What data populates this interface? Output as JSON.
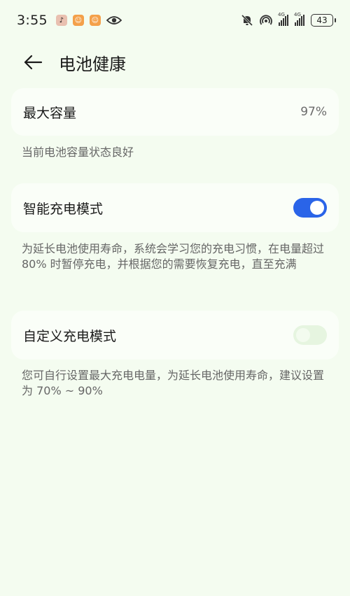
{
  "status_bar": {
    "time": "3:55",
    "battery_level": "43",
    "signal_1_label": "4G",
    "signal_2_label": "4G"
  },
  "header": {
    "title": "电池健康"
  },
  "max_capacity": {
    "label": "最大容量",
    "value": "97%",
    "description": "当前电池容量状态良好"
  },
  "smart_charging": {
    "label": "智能充电模式",
    "enabled": true,
    "description": "为延长电池使用寿命，系统会学习您的充电习惯，在电量超过 80% 时暂停充电，并根据您的需要恢复充电，直至充满"
  },
  "custom_charging": {
    "label": "自定义充电模式",
    "enabled": false,
    "description": "您可自行设置最大充电电量，为延长电池使用寿命，建议设置为 70% ~ 90%"
  },
  "colors": {
    "background": "#f4fcf0",
    "card": "#fafef8",
    "toggle_on": "#2a64e8",
    "toggle_off": "#e6f5e0"
  }
}
